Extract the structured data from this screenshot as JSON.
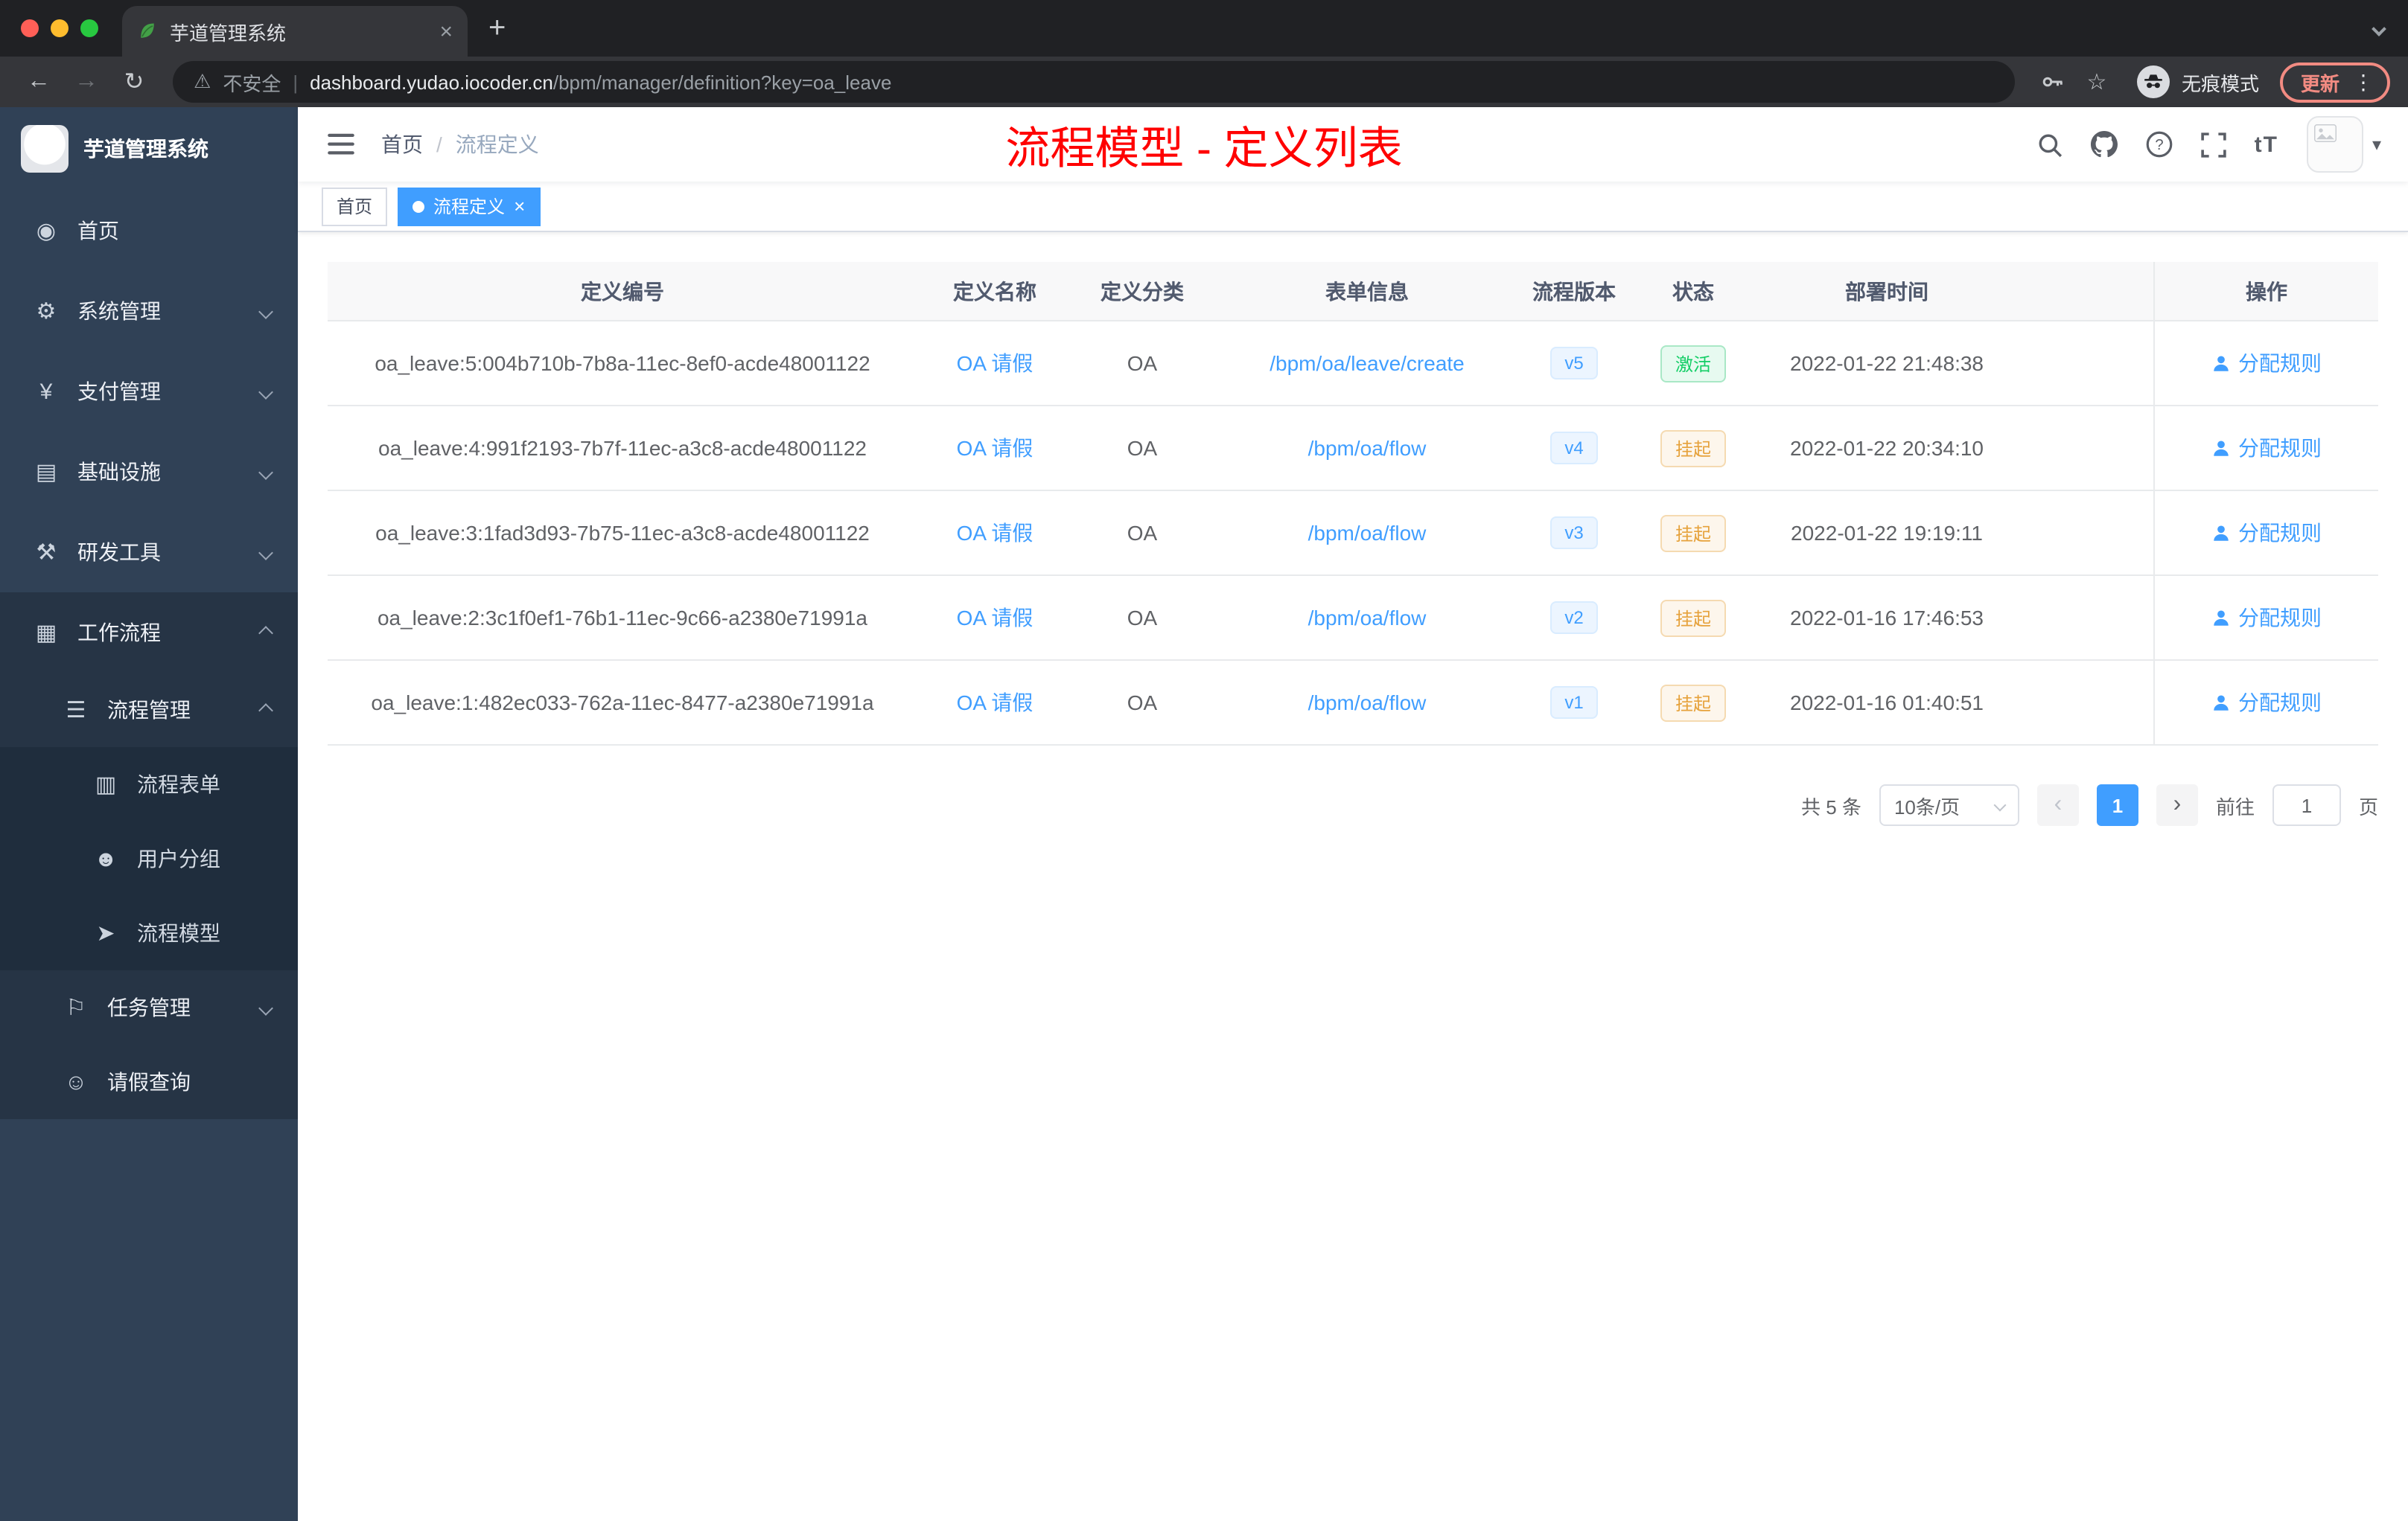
{
  "browser": {
    "tab_title": "芋道管理系统",
    "security_label": "不安全",
    "url_host": "dashboard.yudao.iocoder.cn",
    "url_path": "/bpm/manager/definition?key=oa_leave",
    "incognito_label": "无痕模式",
    "update_label": "更新"
  },
  "icons": {
    "back": "←",
    "forward": "→",
    "reload": "↻",
    "warning": "⚠",
    "divider": "|",
    "star": "☆",
    "more": "⋮",
    "caret": "▾",
    "close": "×",
    "plus": "+",
    "font_size": "tT"
  },
  "sidebar": {
    "logo_title": "芋道管理系统",
    "items": [
      {
        "label": "首页",
        "icon": "◉"
      },
      {
        "label": "系统管理",
        "icon": "⚙"
      },
      {
        "label": "支付管理",
        "icon": "¥"
      },
      {
        "label": "基础设施",
        "icon": "▤"
      },
      {
        "label": "研发工具",
        "icon": "⚒"
      },
      {
        "label": "工作流程",
        "icon": "▦"
      },
      {
        "label": "流程管理",
        "icon": "☰"
      },
      {
        "label": "流程表单",
        "icon": "▥"
      },
      {
        "label": "用户分组",
        "icon": "☻"
      },
      {
        "label": "流程模型",
        "icon": "➤"
      },
      {
        "label": "任务管理",
        "icon": "⚐"
      },
      {
        "label": "请假查询",
        "icon": "☺"
      }
    ]
  },
  "navbar": {
    "breadcrumb_home": "首页",
    "breadcrumb_sep": "/",
    "breadcrumb_current": "流程定义",
    "page_title": "流程模型 - 定义列表"
  },
  "tags": {
    "home": "首页",
    "active": "流程定义"
  },
  "table": {
    "columns": [
      "定义编号",
      "定义名称",
      "定义分类",
      "表单信息",
      "流程版本",
      "状态",
      "部署时间",
      "操作"
    ],
    "rows": [
      {
        "id": "oa_leave:5:004b710b-7b8a-11ec-8ef0-acde48001122",
        "name": "OA 请假",
        "category": "OA",
        "form": "/bpm/oa/leave/create",
        "version": "v5",
        "status": "激活",
        "time": "2022-01-22 21:48:38",
        "action": "分配规则"
      },
      {
        "id": "oa_leave:4:991f2193-7b7f-11ec-a3c8-acde48001122",
        "name": "OA 请假",
        "category": "OA",
        "form": "/bpm/oa/flow",
        "version": "v4",
        "status": "挂起",
        "time": "2022-01-22 20:34:10",
        "action": "分配规则"
      },
      {
        "id": "oa_leave:3:1fad3d93-7b75-11ec-a3c8-acde48001122",
        "name": "OA 请假",
        "category": "OA",
        "form": "/bpm/oa/flow",
        "version": "v3",
        "status": "挂起",
        "time": "2022-01-22 19:19:11",
        "action": "分配规则"
      },
      {
        "id": "oa_leave:2:3c1f0ef1-76b1-11ec-9c66-a2380e71991a",
        "name": "OA 请假",
        "category": "OA",
        "form": "/bpm/oa/flow",
        "version": "v2",
        "status": "挂起",
        "time": "2022-01-16 17:46:53",
        "action": "分配规则"
      },
      {
        "id": "oa_leave:1:482ec033-762a-11ec-8477-a2380e71991a",
        "name": "OA 请假",
        "category": "OA",
        "form": "/bpm/oa/flow",
        "version": "v1",
        "status": "挂起",
        "time": "2022-01-16 01:40:51",
        "action": "分配规则"
      }
    ]
  },
  "pagination": {
    "total": "共 5 条",
    "page_size": "10条/页",
    "prev": "‹",
    "page": "1",
    "next": "›",
    "goto": "前往",
    "goto_value": "1",
    "unit": "页"
  }
}
